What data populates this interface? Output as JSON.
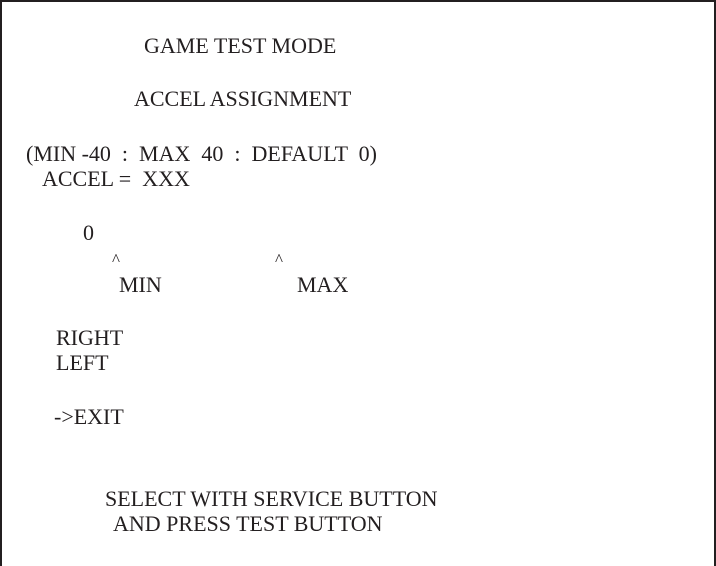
{
  "screen": {
    "title": "GAME TEST MODE",
    "subtitle": "ACCEL ASSIGNMENT",
    "range_note": "(MIN -40  :  MAX  40  :  DEFAULT  0)",
    "accel_readout": "ACCEL =  XXX",
    "gauge": {
      "value_label": "0",
      "min_marker": "^",
      "max_marker": "^",
      "min_label": "MIN",
      "max_label": "MAX"
    },
    "menu": {
      "items": [
        {
          "label": "RIGHT"
        },
        {
          "label": "LEFT"
        }
      ],
      "exit_label": "->EXIT"
    },
    "instructions": {
      "line1": "SELECT WITH SERVICE BUTTON",
      "line2": "AND PRESS TEST BUTTON"
    }
  }
}
